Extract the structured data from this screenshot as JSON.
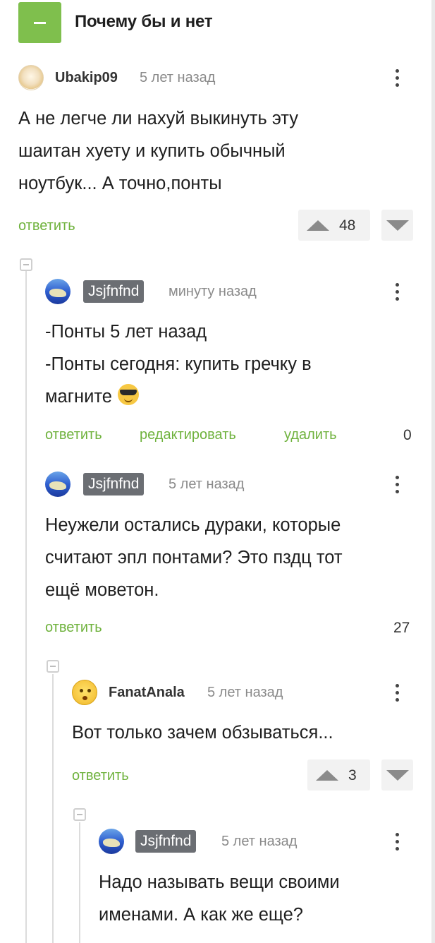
{
  "topic": {
    "title": "Почему бы и нет"
  },
  "comments": [
    {
      "author": "Ubakip09",
      "time": "5 лет назад",
      "lines": [
        "А не легче ли нахуй выкинуть эту",
        "шаитан хуету и купить обычный",
        "ноутбук... А точно,понты"
      ],
      "reply": "ответить",
      "score": "48"
    },
    {
      "author": "Jsjfnfnd",
      "time": "минуту назад",
      "lines": [
        "-Понты 5 лет назад",
        "-Понты сегодня: купить гречку в",
        "магните"
      ],
      "reply": "ответить",
      "edit": "редактировать",
      "delete": "удалить",
      "score": "0"
    },
    {
      "author": "Jsjfnfnd",
      "time": "5 лет назад",
      "lines": [
        "Неужели остались дураки, которые",
        "считают эпл понтами? Это пздц тот",
        "ещё моветон."
      ],
      "reply": "ответить",
      "score": "27"
    },
    {
      "author": "FanatAnala",
      "time": "5 лет назад",
      "lines": [
        "Вот только зачем обзываться..."
      ],
      "reply": "ответить",
      "score": "3"
    },
    {
      "author": "Jsjfnfnd",
      "time": "5 лет назад",
      "lines": [
        "Надо называть вещи своими",
        "именами. А как же еще?"
      ]
    }
  ],
  "colors": {
    "accent_green": "#7fbf4d",
    "link_green": "#6fb23d",
    "badge_gray": "#6b6e73"
  }
}
